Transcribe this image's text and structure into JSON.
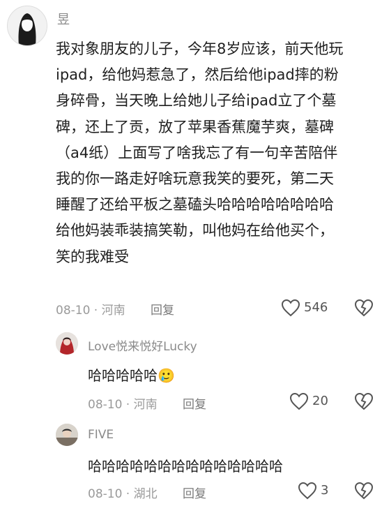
{
  "main_comment": {
    "username": "昱",
    "body_lines": [
      "我对象朋友的儿子，今年8岁应该，前天他玩",
      "ipad，给他妈惹急了，然后给他ipad摔的粉",
      "身碎骨，当天晚上给她儿子给ipad立了个墓",
      "碑，还上了贡，放了苹果香蕉魔芋爽，墓碑",
      "（a4纸）上面写了啥我忘了有一句辛苦陪伴",
      "我的你一路走好啥玩意我笑的要死，第二天",
      "睡醒了还给平板之墓磕头哈哈哈哈哈哈哈哈",
      "给他妈装乖装搞笑勒，叫他妈在给他买个，",
      "笑的我难受"
    ],
    "meta": "08-10 · 河南",
    "reply_label": "回复",
    "likes": "546"
  },
  "replies": [
    {
      "username": "Love悦来悦好Lucky",
      "text": "哈哈哈哈哈",
      "emoji": "🥲",
      "meta": "08-10 · 河南",
      "reply_label": "回复",
      "likes": "20"
    },
    {
      "username": "FIVE",
      "text": "哈哈哈哈哈哈哈哈哈哈哈哈哈哈",
      "meta": "08-10 · 湖北",
      "reply_label": "回复",
      "likes": "3"
    }
  ],
  "icons": {
    "like": "heart-outline-icon",
    "dislike": "broken-heart-icon"
  },
  "colors": {
    "text": "#1f1f1f",
    "muted": "#9a9a9a",
    "icon": "#555555"
  }
}
